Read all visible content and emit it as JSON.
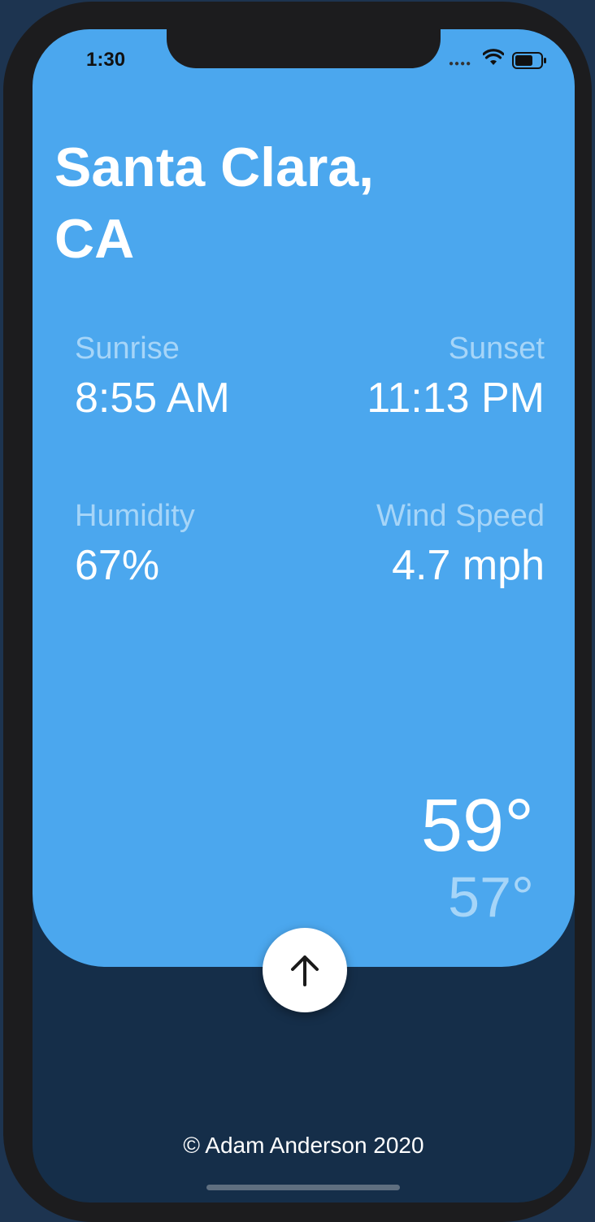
{
  "status_bar": {
    "time": "1:30",
    "icons": [
      "signal-dots-icon",
      "wifi-icon",
      "battery-icon"
    ]
  },
  "location": {
    "line1": "Santa Clara,",
    "line2": "CA"
  },
  "stats": {
    "sunrise": {
      "label": "Sunrise",
      "value": "8:55 AM"
    },
    "sunset": {
      "label": "Sunset",
      "value": "11:13 PM"
    },
    "humidity": {
      "label": "Humidity",
      "value": "67%"
    },
    "wind_speed": {
      "label": "Wind Speed",
      "value": "4.7 mph"
    }
  },
  "temperature": {
    "high": "59°",
    "low": "57°"
  },
  "expand_button": {
    "icon": "arrow-up-icon"
  },
  "footer": {
    "text": "© Adam Anderson 2020"
  },
  "colors": {
    "card": "#4ba7ee",
    "background": "#152e49",
    "muted_text": "#a6d5f8",
    "primary_text": "#ffffff"
  }
}
